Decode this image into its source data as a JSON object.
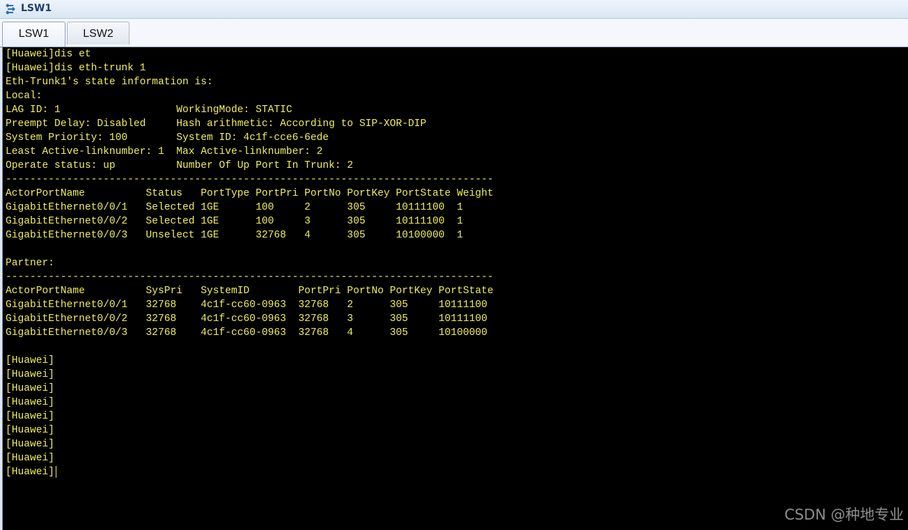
{
  "window": {
    "title": "LSW1"
  },
  "tabs": [
    {
      "label": "LSW1",
      "active": true
    },
    {
      "label": "LSW2",
      "active": false
    }
  ],
  "terminal": {
    "text_color": "#f0ee5a",
    "background": "#000000",
    "lines": [
      "[Huawei]dis et",
      "[Huawei]dis eth-trunk 1",
      "Eth-Trunk1's state information is:",
      "Local:",
      "LAG ID: 1                   WorkingMode: STATIC",
      "Preempt Delay: Disabled     Hash arithmetic: According to SIP-XOR-DIP",
      "System Priority: 100        System ID: 4c1f-cce6-6ede",
      "Least Active-linknumber: 1  Max Active-linknumber: 2",
      "Operate status: up          Number Of Up Port In Trunk: 2",
      "--------------------------------------------------------------------------------",
      "ActorPortName          Status   PortType PortPri PortNo PortKey PortState Weight",
      "GigabitEthernet0/0/1   Selected 1GE      100     2      305     10111100  1",
      "GigabitEthernet0/0/2   Selected 1GE      100     3      305     10111100  1",
      "GigabitEthernet0/0/3   Unselect 1GE      32768   4      305     10100000  1",
      "",
      "Partner:",
      "--------------------------------------------------------------------------------",
      "ActorPortName          SysPri   SystemID        PortPri PortNo PortKey PortState",
      "GigabitEthernet0/0/1   32768    4c1f-cc60-0963  32768   2      305     10111100",
      "GigabitEthernet0/0/2   32768    4c1f-cc60-0963  32768   3      305     10111100",
      "GigabitEthernet0/0/3   32768    4c1f-cc60-0963  32768   4      305     10100000",
      "",
      "[Huawei]",
      "[Huawei]",
      "[Huawei]",
      "[Huawei]",
      "[Huawei]",
      "[Huawei]",
      "[Huawei]",
      "[Huawei]"
    ],
    "prompt_line": "[Huawei]"
  },
  "watermark": "CSDN @种地专业",
  "icons": {
    "app": "network-switch-icon",
    "cursor": "text-cursor-icon"
  }
}
